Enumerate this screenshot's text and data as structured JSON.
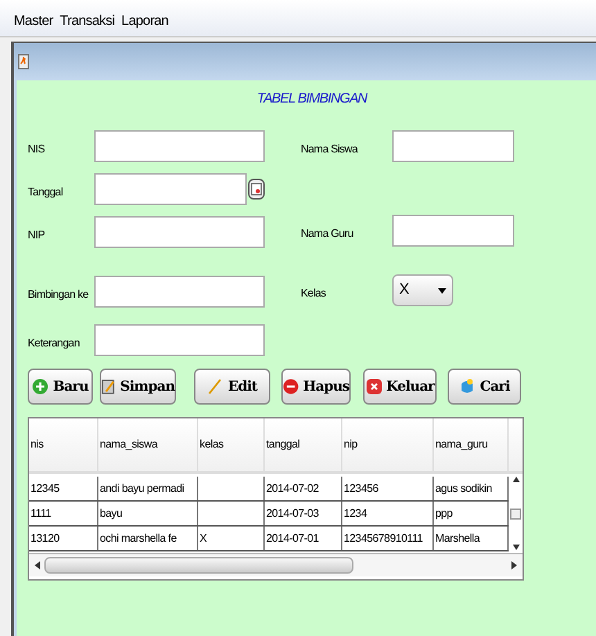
{
  "menu": [
    "Master",
    "Transaksi",
    "Laporan"
  ],
  "title": "TABEL BIMBINGAN",
  "form_left": [
    {
      "label": "NIS",
      "kind": "text"
    },
    {
      "label": "Tanggal",
      "kind": "date"
    },
    {
      "label": "NIP",
      "kind": "text"
    },
    {
      "label": "Bimbingan ke",
      "kind": "text"
    },
    {
      "label": "Keterangan",
      "kind": "text"
    }
  ],
  "form_right": [
    {
      "label": "Nama Siswa",
      "kind": "text"
    },
    {
      "label": "Nama Guru",
      "kind": "text"
    },
    {
      "label": "Kelas",
      "kind": "select",
      "value": "X"
    }
  ],
  "buttons": [
    {
      "label": "Baru",
      "kind": "new"
    },
    {
      "label": "Simpan",
      "kind": "save"
    },
    {
      "label": "Edit",
      "kind": "edit"
    },
    {
      "label": "Hapus",
      "kind": "delete"
    },
    {
      "label": "Keluar",
      "kind": "exit"
    },
    {
      "label": "Cari",
      "kind": "search"
    }
  ],
  "table": {
    "columns": [
      "nis",
      "nama_siswa",
      "kelas",
      "tanggal",
      "nip",
      "nama_guru"
    ],
    "rows": [
      [
        "12345",
        "andi bayu permadi",
        "",
        "2014-07-02",
        "123456",
        "agus sodikin"
      ],
      [
        "1111",
        "bayu",
        "",
        "2014-07-03",
        "1234",
        "ppp"
      ],
      [
        "13120",
        "ochi marshella fe",
        "X",
        "2014-07-01",
        "12345678910111",
        "Marshella"
      ]
    ]
  }
}
